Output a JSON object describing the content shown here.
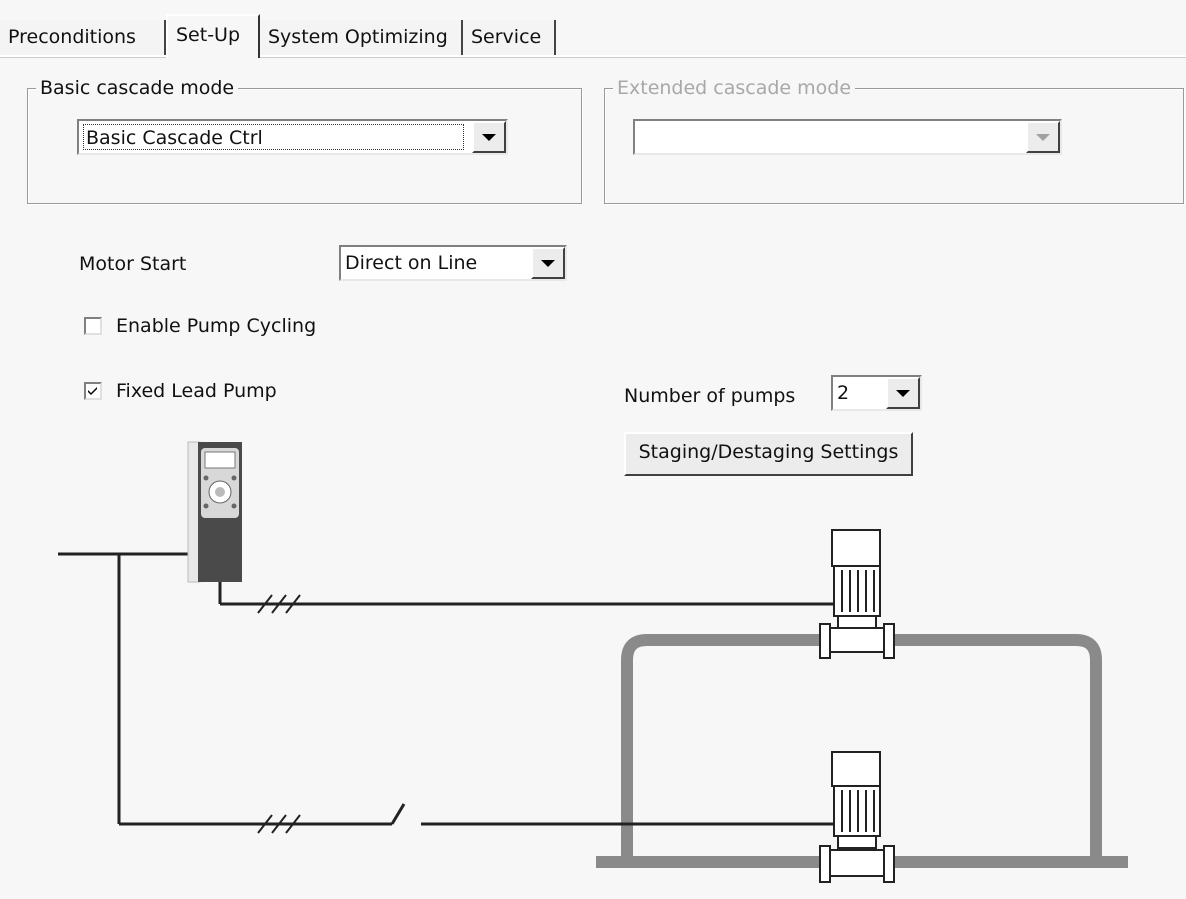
{
  "tabs": [
    {
      "label": "Preconditions"
    },
    {
      "label": "Set-Up",
      "active": true
    },
    {
      "label": "System Optimizing"
    },
    {
      "label": "Service"
    }
  ],
  "basic_cascade": {
    "legend": "Basic cascade mode",
    "selected": "Basic Cascade Ctrl"
  },
  "extended_cascade": {
    "legend": "Extended cascade mode",
    "selected": "",
    "enabled": false
  },
  "motor_start": {
    "label": "Motor Start",
    "selected": "Direct on Line"
  },
  "enable_pump_cycling": {
    "label": "Enable Pump Cycling",
    "checked": false
  },
  "fixed_lead_pump": {
    "label": "Fixed Lead Pump",
    "checked": true
  },
  "number_of_pumps": {
    "label": "Number of pumps",
    "selected": "2"
  },
  "staging_button": {
    "label": "Staging/Destaging Settings"
  },
  "colors": {
    "pipe": "#8a8a8a",
    "wire": "#222222",
    "drive_body": "#4a4a4a"
  },
  "icons": [
    "dropdown-arrow-icon",
    "checkmark-icon",
    "frequency-drive-icon",
    "pump-icon"
  ]
}
